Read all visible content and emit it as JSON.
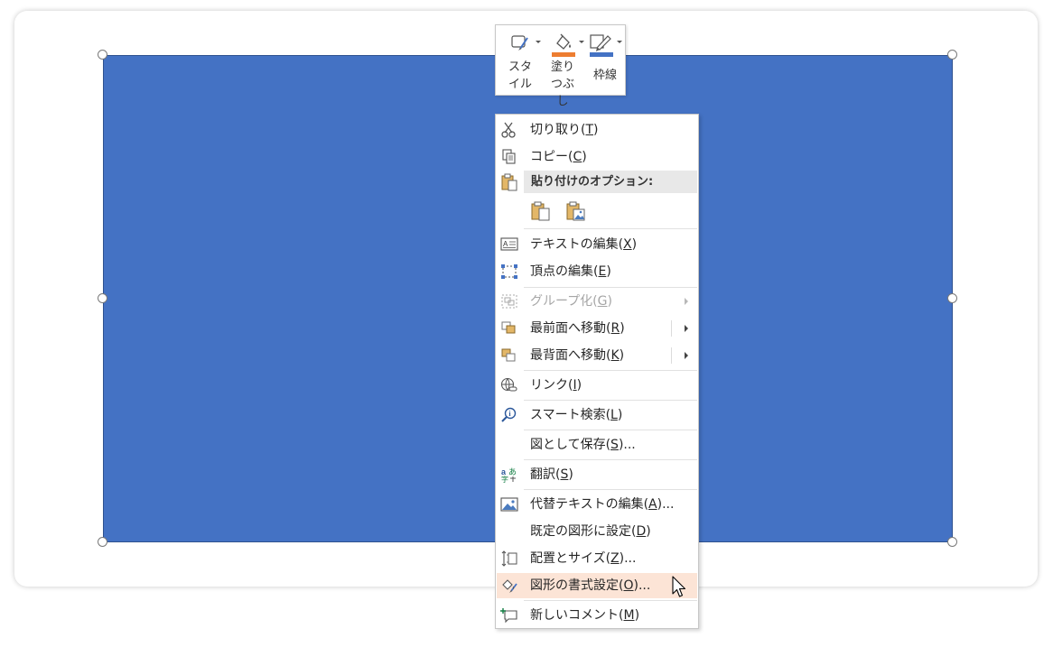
{
  "mini_toolbar": {
    "style_label": "スタイル",
    "fill_label": "塗りつぶし",
    "outline_label": "枠線",
    "fill_color": "#ed7d31",
    "outline_color": "#4472c4"
  },
  "shape": {
    "fill_color": "#4472c4"
  },
  "context_menu": {
    "cut": {
      "text": "切り取り(",
      "key": "T",
      "end": ")"
    },
    "copy": {
      "text": "コピー(",
      "key": "C",
      "end": ")"
    },
    "paste_options_header": "貼り付けのオプション:",
    "edit_text": {
      "text": "テキストの編集(",
      "key": "X",
      "end": ")"
    },
    "edit_points": {
      "text": "頂点の編集(",
      "key": "E",
      "end": ")"
    },
    "group": {
      "text": "グループ化(",
      "key": "G",
      "end": ")"
    },
    "bring_to_front": {
      "text": "最前面へ移動(",
      "key": "R",
      "end": ")"
    },
    "send_to_back": {
      "text": "最背面へ移動(",
      "key": "K",
      "end": ")"
    },
    "link": {
      "text": "リンク(",
      "key": "I",
      "end": ")"
    },
    "smart_lookup": {
      "text": "スマート検索(",
      "key": "L",
      "end": ")"
    },
    "save_as_picture": {
      "text": "図として保存(",
      "key": "S",
      "end": ")..."
    },
    "translate": {
      "text": "翻訳(",
      "key": "S",
      "end": ")"
    },
    "edit_alt_text": {
      "text": "代替テキストの編集(",
      "key": "A",
      "end": ")..."
    },
    "set_default_shape": {
      "text": "既定の図形に設定(",
      "key": "D",
      "end": ")"
    },
    "size_position": {
      "text": "配置とサイズ(",
      "key": "Z",
      "end": ")..."
    },
    "format_shape": {
      "text": "図形の書式設定(",
      "key": "O",
      "end": ")..."
    },
    "new_comment": {
      "text": "新しいコメント(",
      "key": "M",
      "end": ")"
    }
  }
}
